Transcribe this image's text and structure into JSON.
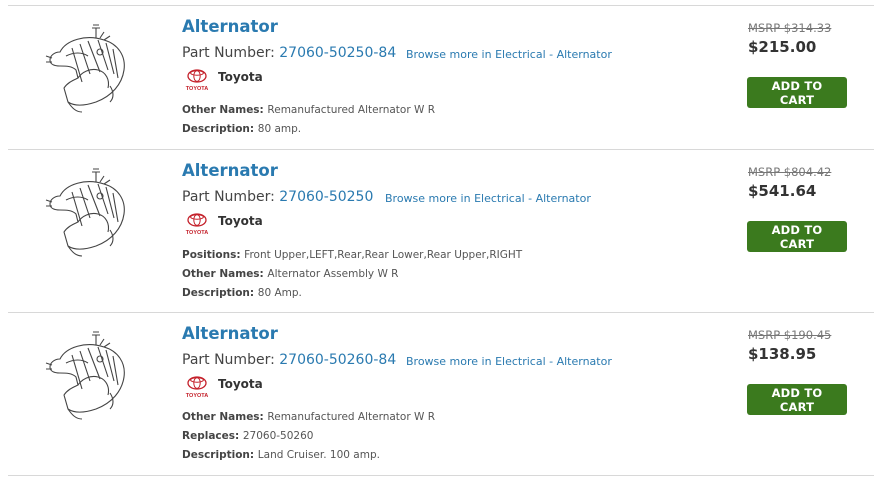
{
  "labels": {
    "part_number": "Part Number: ",
    "other_names": "Other Names: ",
    "description": "Description: ",
    "positions": "Positions: ",
    "replaces": "Replaces: ",
    "add_to_cart": "ADD TO CART",
    "logo_text": "TOYOTA"
  },
  "products": [
    {
      "title": "Alternator",
      "part_number": "27060-50250-84",
      "browse": "Browse more in Electrical - Alternator",
      "brand": "Toyota",
      "other_names": "Remanufactured Alternator W R",
      "description": "80 amp.",
      "msrp": "MSRP $314.33",
      "price": "$215.00"
    },
    {
      "title": "Alternator",
      "part_number": "27060-50250",
      "browse": "Browse more in Electrical - Alternator",
      "brand": "Toyota",
      "positions": "Front Upper,LEFT,Rear,Rear Lower,Rear Upper,RIGHT",
      "other_names": "Alternator Assembly W R",
      "description": "80 Amp.",
      "msrp": "MSRP $804.42",
      "price": "$541.64"
    },
    {
      "title": "Alternator",
      "part_number": "27060-50260-84",
      "browse": "Browse more in Electrical - Alternator",
      "brand": "Toyota",
      "other_names": "Remanufactured Alternator W R",
      "replaces": "27060-50260",
      "description": "Land Cruiser. 100 amp.",
      "msrp": "MSRP $190.45",
      "price": "$138.95"
    }
  ]
}
